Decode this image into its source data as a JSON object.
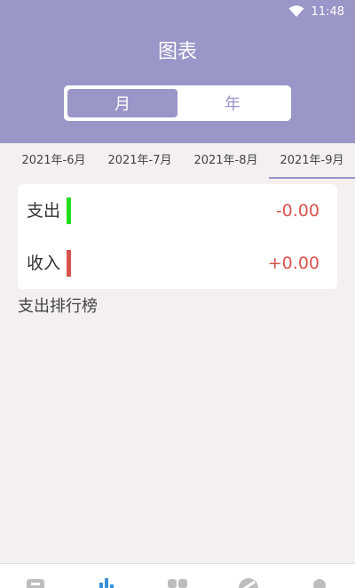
{
  "status": {
    "time": "11:48"
  },
  "header": {
    "title": "图表"
  },
  "segment": {
    "month_label": "月",
    "year_label": "年"
  },
  "month_tabs": [
    {
      "label": "2021年-6月"
    },
    {
      "label": "2021年-7月"
    },
    {
      "label": "2021年-8月"
    },
    {
      "label": "2021年-9月"
    }
  ],
  "summary": {
    "expense_label": "支出",
    "expense_value": "-0.00",
    "income_label": "收入",
    "income_value": "+0.00"
  },
  "ranking": {
    "title": "支出排行榜"
  },
  "colors": {
    "accent": "#9a96c8",
    "expense_bar": "#22dd22",
    "income_bar": "#d9534f",
    "value_red": "#d9534f",
    "nav_active": "#3a8fd8"
  }
}
